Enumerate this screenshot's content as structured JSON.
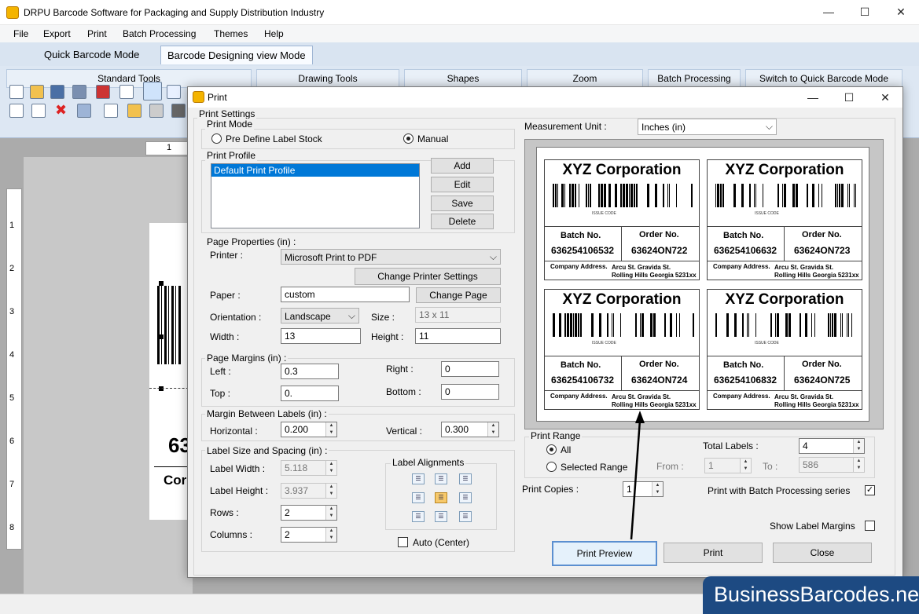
{
  "app": {
    "title": "DRPU Barcode Software for Packaging and Supply Distribution Industry"
  },
  "window_controls": {
    "minimize": "—",
    "maximize": "☐",
    "close": "✕"
  },
  "menu": [
    "File",
    "Export",
    "Print",
    "Batch Processing",
    "Themes",
    "Help"
  ],
  "mode_tabs": [
    "Quick Barcode Mode",
    "Barcode Designing view Mode"
  ],
  "ribbon": {
    "groups": [
      "Standard Tools",
      "Drawing Tools",
      "Shapes",
      "Zoom",
      "Batch Processing",
      "Switch to Quick Barcode Mode"
    ]
  },
  "rulers": {
    "h": [
      "1"
    ],
    "v": [
      "1",
      "2",
      "3",
      "4",
      "5",
      "6",
      "7",
      "8"
    ]
  },
  "canvas_preview": {
    "number_fragment": "63",
    "company_fragment": "Cor"
  },
  "dialog": {
    "title": "Print",
    "print_settings_label": "Print Settings",
    "print_mode": {
      "label": "Print Mode",
      "options": [
        "Pre Define Label Stock",
        "Manual"
      ],
      "selected": "Manual"
    },
    "print_profile": {
      "label": "Print Profile",
      "items": [
        "Default Print Profile"
      ],
      "buttons": [
        "Add",
        "Edit",
        "Save",
        "Delete"
      ]
    },
    "page_properties": {
      "label": "Page Properties (in) :",
      "printer_label": "Printer :",
      "printer": "Microsoft Print to PDF",
      "change_printer_button": "Change Printer Settings",
      "paper_label": "Paper :",
      "paper": "custom",
      "change_page_button": "Change Page",
      "orientation_label": "Orientation :",
      "orientation": "Landscape",
      "size_label": "Size :",
      "size": "13 x 11",
      "width_label": "Width :",
      "width": "13",
      "height_label": "Height :",
      "height": "11"
    },
    "page_margins": {
      "label": "Page Margins (in) :",
      "left_label": "Left :",
      "left": "0.3",
      "right_label": "Right :",
      "right": "0",
      "top_label": "Top :",
      "top": "0.",
      "bottom_label": "Bottom :",
      "bottom": "0"
    },
    "margin_between": {
      "label": "Margin Between Labels (in) :",
      "horizontal_label": "Horizontal :",
      "horizontal": "0.200",
      "vertical_label": "Vertical :",
      "vertical": "0.300"
    },
    "label_size": {
      "label": "Label Size and Spacing (in) :",
      "label_width_label": "Label Width :",
      "label_width": "5.118",
      "label_height_label": "Label Height :",
      "label_height": "3.937",
      "rows_label": "Rows :",
      "rows": "2",
      "columns_label": "Columns :",
      "columns": "2",
      "alignments_label": "Label Alignments",
      "auto_center_label": "Auto (Center)"
    },
    "measurement": {
      "label": "Measurement Unit :",
      "value": "Inches (in)"
    },
    "preview_labels": [
      {
        "company": "XYZ Corporation",
        "batch_head": "Batch No.",
        "batch": "636254106532",
        "order_head": "Order No.",
        "order": "63624ON722",
        "address_head": "Company Address.",
        "address1": "Arcu St. Gravida St.",
        "address2": "Rolling Hills Georgia 5231xx",
        "barcode_text": "ISSUE CODE"
      },
      {
        "company": "XYZ Corporation",
        "batch_head": "Batch No.",
        "batch": "636254106632",
        "order_head": "Order No.",
        "order": "63624ON723",
        "address_head": "Company Address.",
        "address1": "Arcu St. Gravida St.",
        "address2": "Rolling Hills Georgia 5231xx",
        "barcode_text": "ISSUE CODE"
      },
      {
        "company": "XYZ Corporation",
        "batch_head": "Batch No.",
        "batch": "636254106732",
        "order_head": "Order No.",
        "order": "63624ON724",
        "address_head": "Company Address.",
        "address1": "Arcu St. Gravida St.",
        "address2": "Rolling Hills Georgia 5231xx",
        "barcode_text": "ISSUE CODE"
      },
      {
        "company": "XYZ Corporation",
        "batch_head": "Batch No.",
        "batch": "636254106832",
        "order_head": "Order No.",
        "order": "63624ON725",
        "address_head": "Company Address.",
        "address1": "Arcu St. Gravida St.",
        "address2": "Rolling Hills Georgia 5231xx",
        "barcode_text": "ISSUE CODE"
      }
    ],
    "print_range": {
      "label": "Print Range",
      "all_label": "All",
      "selected_range_label": "Selected Range",
      "selected": "All",
      "total_labels_label": "Total Labels :",
      "total_labels": "4",
      "from_label": "From :",
      "from": "1",
      "to_label": "To :",
      "to": "586"
    },
    "print_copies": {
      "label": "Print Copies :",
      "value": "1"
    },
    "batch_series": {
      "label": "Print with Batch Processing series",
      "checked": true
    },
    "show_margins": {
      "label": "Show Label Margins",
      "checked": false
    },
    "buttons": {
      "preview": "Print Preview",
      "print": "Print",
      "close": "Close"
    }
  },
  "watermark": "BusinessBarcodes.net"
}
